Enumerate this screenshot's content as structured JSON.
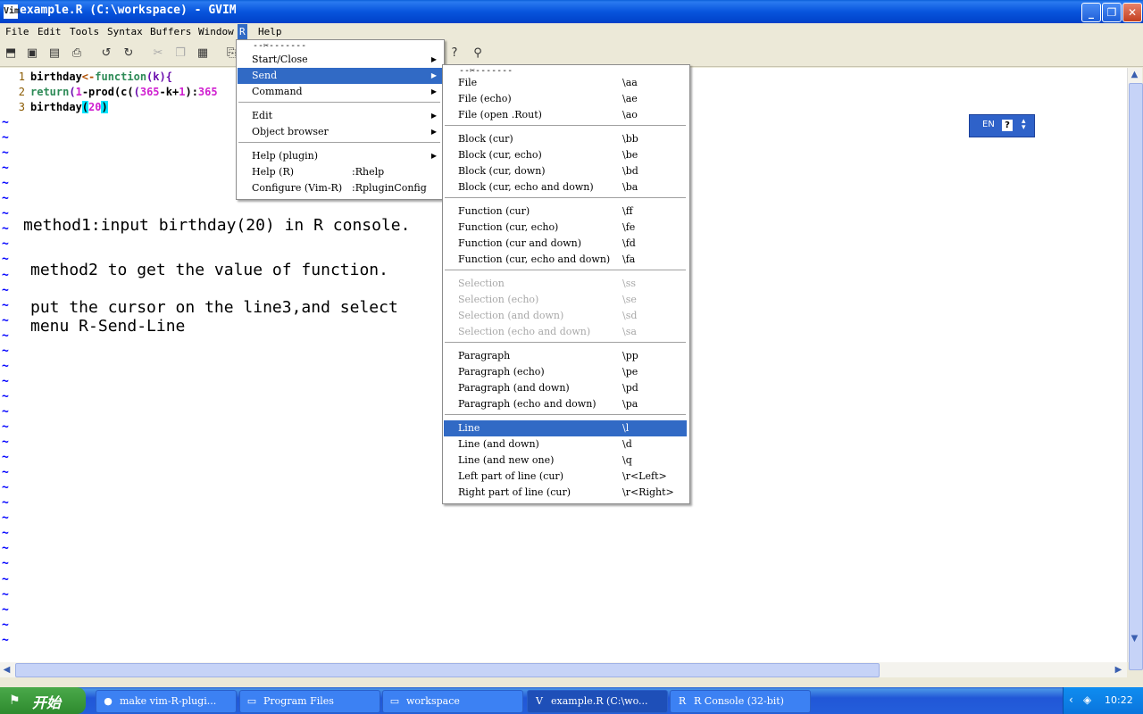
{
  "window": {
    "title": "example.R (C:\\workspace) - GVIM",
    "app_icon_label": "Vim",
    "minimize_glyph": "_",
    "maximize_glyph": "❐",
    "close_glyph": "✕"
  },
  "menubar": {
    "items": [
      "File",
      "Edit",
      "Tools",
      "Syntax",
      "Buffers",
      "Window",
      "R",
      "Help"
    ]
  },
  "editor": {
    "code_lines": [
      {
        "num": "1"
      },
      {
        "num": "2"
      },
      {
        "num": "3"
      }
    ],
    "line1": {
      "a": "birthday",
      "b": "<-",
      "c": "function",
      "d": "(k){"
    },
    "line2": {
      "a": "return",
      "b": "(",
      "c": "1",
      "d": "-prod(c(",
      "e": "(",
      "f": "365",
      "g": "-k+",
      "h": "1",
      "i": "):",
      "j": "365"
    },
    "line3": {
      "a": "birthday",
      "b": "(",
      "c": "20",
      "d": ")"
    },
    "tilde": "~",
    "notes": [
      "method1:input birthday(20) in R console.",
      "method2 to get the value of function.",
      "put the cursor on the line3,and select",
      "menu R-Send-Line"
    ]
  },
  "r_menu": {
    "tearoff": "--✂-------",
    "items": [
      {
        "label": "Start/Close",
        "submenu": true
      },
      {
        "label": "Send",
        "submenu": true,
        "selected": true
      },
      {
        "label": "Command",
        "submenu": true
      },
      {
        "label": "Edit",
        "submenu": true
      },
      {
        "label": "Object browser",
        "submenu": true
      },
      {
        "label": "Help (plugin)",
        "submenu": true
      },
      {
        "label": "Help (R)",
        "accel": ":Rhelp"
      },
      {
        "label": "Configure (Vim-R)",
        "accel": ":RpluginConfig"
      }
    ]
  },
  "send_menu": {
    "tearoff": "--✂-------",
    "items": [
      {
        "label": "File",
        "accel": "\\aa"
      },
      {
        "label": "File (echo)",
        "accel": "\\ae"
      },
      {
        "label": "File (open .Rout)",
        "accel": "\\ao"
      },
      {
        "label": "Block (cur)",
        "accel": "\\bb"
      },
      {
        "label": "Block (cur, echo)",
        "accel": "\\be"
      },
      {
        "label": "Block (cur, down)",
        "accel": "\\bd"
      },
      {
        "label": "Block (cur, echo and down)",
        "accel": "\\ba"
      },
      {
        "label": "Function (cur)",
        "accel": "\\ff"
      },
      {
        "label": "Function (cur, echo)",
        "accel": "\\fe"
      },
      {
        "label": "Function (cur and down)",
        "accel": "\\fd"
      },
      {
        "label": "Function (cur, echo and down)",
        "accel": "\\fa"
      },
      {
        "label": "Selection",
        "accel": "\\ss",
        "disabled": true
      },
      {
        "label": "Selection (echo)",
        "accel": "\\se",
        "disabled": true
      },
      {
        "label": "Selection (and down)",
        "accel": "\\sd",
        "disabled": true
      },
      {
        "label": "Selection (echo and down)",
        "accel": "\\sa",
        "disabled": true
      },
      {
        "label": "Paragraph",
        "accel": "\\pp"
      },
      {
        "label": "Paragraph (echo)",
        "accel": "\\pe"
      },
      {
        "label": "Paragraph (and down)",
        "accel": "\\pd"
      },
      {
        "label": "Paragraph (echo and down)",
        "accel": "\\pa"
      },
      {
        "label": "Line",
        "accel": "\\l",
        "selected": true
      },
      {
        "label": "Line (and down)",
        "accel": "\\d"
      },
      {
        "label": "Line (and new one)",
        "accel": "\\q"
      },
      {
        "label": "Left part of line (cur)",
        "accel": "\\r<Left>"
      },
      {
        "label": "Right part of line (cur)",
        "accel": "\\r<Right>"
      }
    ]
  },
  "langbar": {
    "lang": "EN",
    "help": "?"
  },
  "taskbar": {
    "start_label": "开始",
    "tasks": [
      {
        "label": "make vim-R-plugi...",
        "icon": "firefox-icon",
        "glyph": "●"
      },
      {
        "label": "Program Files",
        "icon": "folder-icon",
        "glyph": "▭"
      },
      {
        "label": "workspace",
        "icon": "folder-icon",
        "glyph": "▭"
      },
      {
        "label": "example.R (C:\\wo...",
        "icon": "vim-icon",
        "glyph": "V",
        "active": true
      },
      {
        "label": "R Console (32-bit)",
        "icon": "r-icon",
        "glyph": "R"
      }
    ],
    "clock": "10:22"
  },
  "colors": {
    "menu_highlight": "#316ac5",
    "tilde": "#0000ff",
    "keyword": "#2e8b57",
    "number": "#d020d0",
    "matchparen": "#00e5ff"
  }
}
